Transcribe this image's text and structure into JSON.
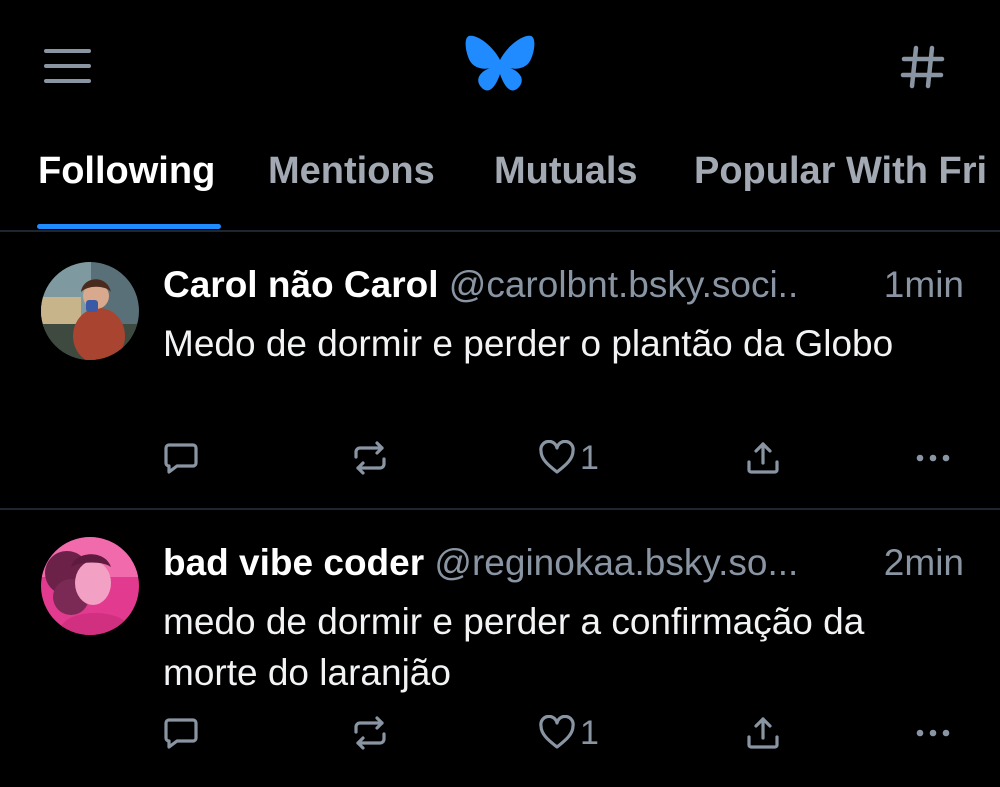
{
  "colors": {
    "background": "#000000",
    "accent": "#208bfe",
    "text_primary": "#ffffff",
    "text_secondary": "#8a95a3",
    "tab_inactive": "#a2a9b3",
    "divider": "#1e2630"
  },
  "header": {
    "menu_icon": "hamburger-menu-icon",
    "logo_icon": "bluesky-butterfly-logo",
    "feeds_icon": "hashtag-icon"
  },
  "tabs": [
    {
      "label": "Following",
      "active": true
    },
    {
      "label": "Mentions",
      "active": false
    },
    {
      "label": "Mutuals",
      "active": false
    },
    {
      "label": "Popular With Fri",
      "active": false
    }
  ],
  "posts": [
    {
      "author_name": "Carol não Carol",
      "handle": "@carolbnt.bsky.soci..",
      "time": "1min",
      "text": "Medo de dormir e perder o plantão da Globo",
      "reply_count": "",
      "repost_count": "",
      "like_count": "1"
    },
    {
      "author_name": "bad vibe coder",
      "handle": "@reginokaa.bsky.so...",
      "time": "2min",
      "text": "medo de dormir e perder a confirmação da morte do laranjão",
      "reply_count": "",
      "repost_count": "",
      "like_count": "1"
    }
  ]
}
